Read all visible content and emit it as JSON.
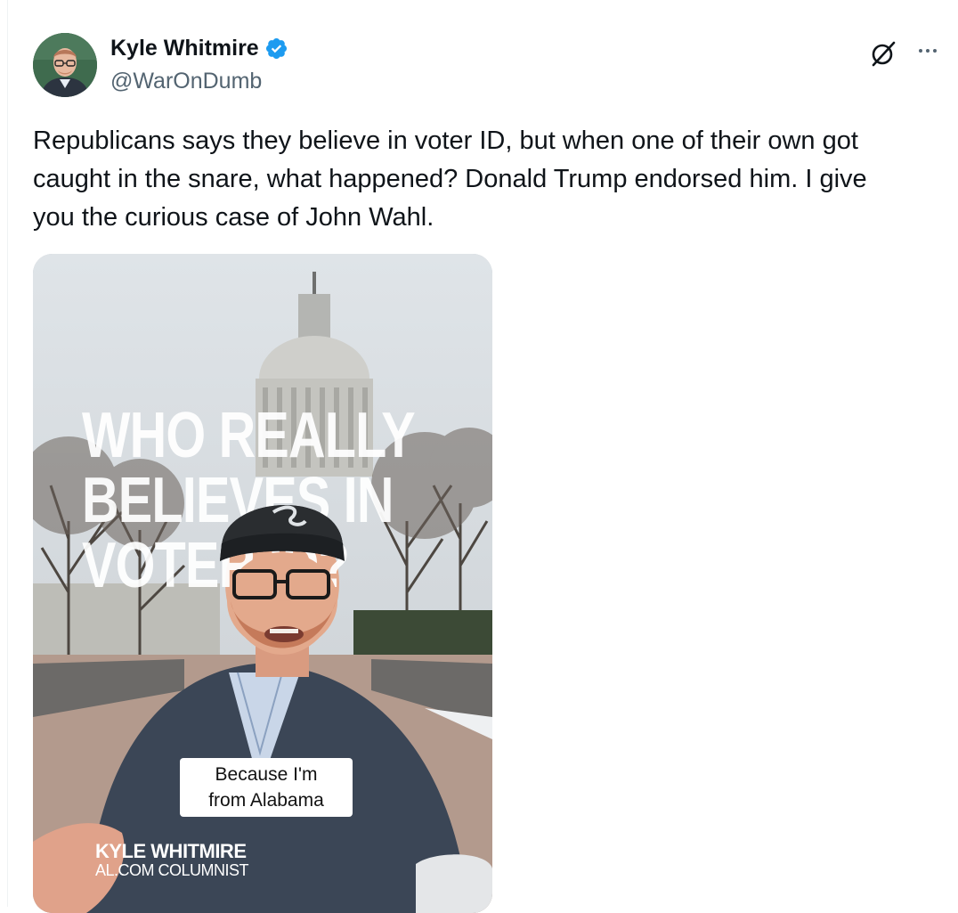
{
  "author": {
    "display_name": "Kyle Whitmire",
    "handle": "@WarOnDumb",
    "verified": true
  },
  "actions": {
    "grok_icon": "grok-icon",
    "more_icon": "more-icon"
  },
  "tweet": {
    "text_lines": [
      "Republicans says they believe in voter ID, but when one of their own got",
      "caught in the snare, what happened? Donald Trump endorsed him. I give",
      "you the curious case of John Wahl."
    ]
  },
  "media": {
    "overlay_lines": [
      "WHO REALLY",
      "BELIEVES IN",
      "VOTER ID?"
    ],
    "caption_lines": [
      "Because I'm",
      "from Alabama"
    ],
    "lower_third_name": "KYLE WHITMIRE",
    "lower_third_role": "AL.COM COLUMNIST"
  },
  "colors": {
    "verified_blue": "#1d9bf0",
    "secondary_text": "#536471",
    "primary_text": "#0f1419"
  }
}
